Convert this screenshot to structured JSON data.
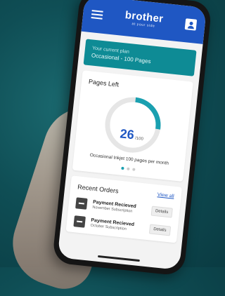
{
  "header": {
    "brand": "brother",
    "tagline": "at your side"
  },
  "plan": {
    "label": "Your current plan",
    "value": "Occasional - 100 Pages"
  },
  "pages_left": {
    "title": "Pages Left",
    "count": "26",
    "unit": "/100",
    "description": "Occasional Inkjet 100 pages per month",
    "fraction": 0.26
  },
  "carousel": {
    "pages": 3,
    "active": 0
  },
  "recent_orders": {
    "title": "Recent Orders",
    "view_all": "View all",
    "items": [
      {
        "title": "Payment Recieved",
        "subtitle": "November Subscription",
        "action": "Details"
      },
      {
        "title": "Payment Recieved",
        "subtitle": "October Subscription",
        "action": "Details"
      }
    ]
  },
  "colors": {
    "header_blue": "#1f57c3",
    "plan_teal": "#0e8b95",
    "gauge_teal": "#1aa0b0"
  }
}
